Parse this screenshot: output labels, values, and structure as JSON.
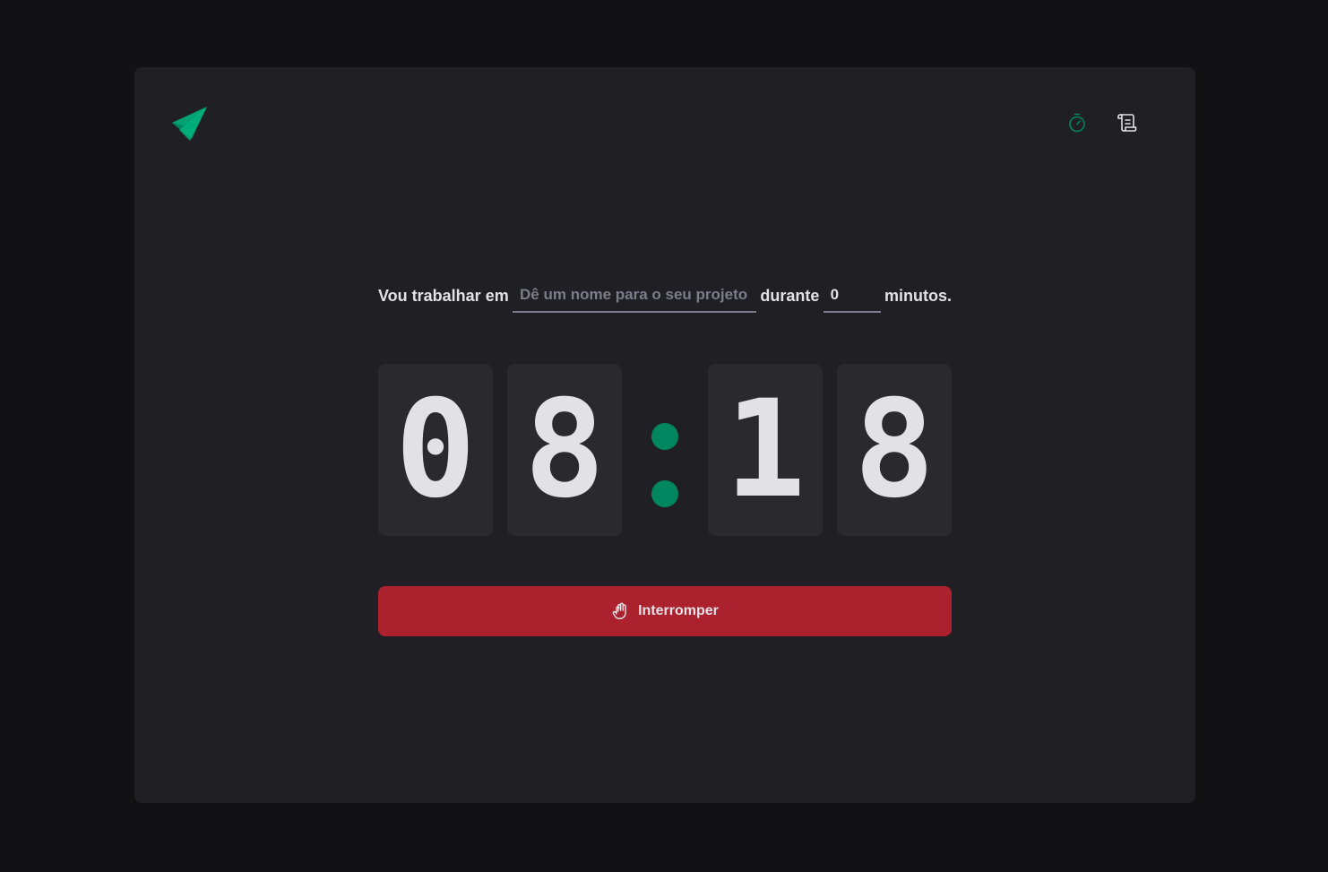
{
  "header": {
    "logo_icon": "paper-plane-logo-icon",
    "nav": [
      {
        "name": "timer",
        "icon": "timer-icon",
        "active": true
      },
      {
        "name": "history",
        "icon": "scroll-icon",
        "active": false
      }
    ]
  },
  "form": {
    "task_label": "Vou trabalhar em",
    "task_placeholder": "Dê um nome para o seu projeto",
    "task_value": "",
    "duration_label": "durante",
    "minutes_value": "0",
    "minutes_suffix": "minutos."
  },
  "countdown": {
    "minutes_tens": "0",
    "minutes_ones": "8",
    "separator": ":",
    "seconds_tens": "1",
    "seconds_ones": "8"
  },
  "stop_button": {
    "label": "Interromper",
    "icon": "hand-palm-icon"
  },
  "colors": {
    "background": "#121214",
    "panel": "#202024",
    "digit_bg": "#29292e",
    "accent": "#00875f",
    "accent_light": "#00b37e",
    "danger": "#ab222e",
    "text": "#e1e1e6",
    "placeholder": "#7c7c8a"
  }
}
